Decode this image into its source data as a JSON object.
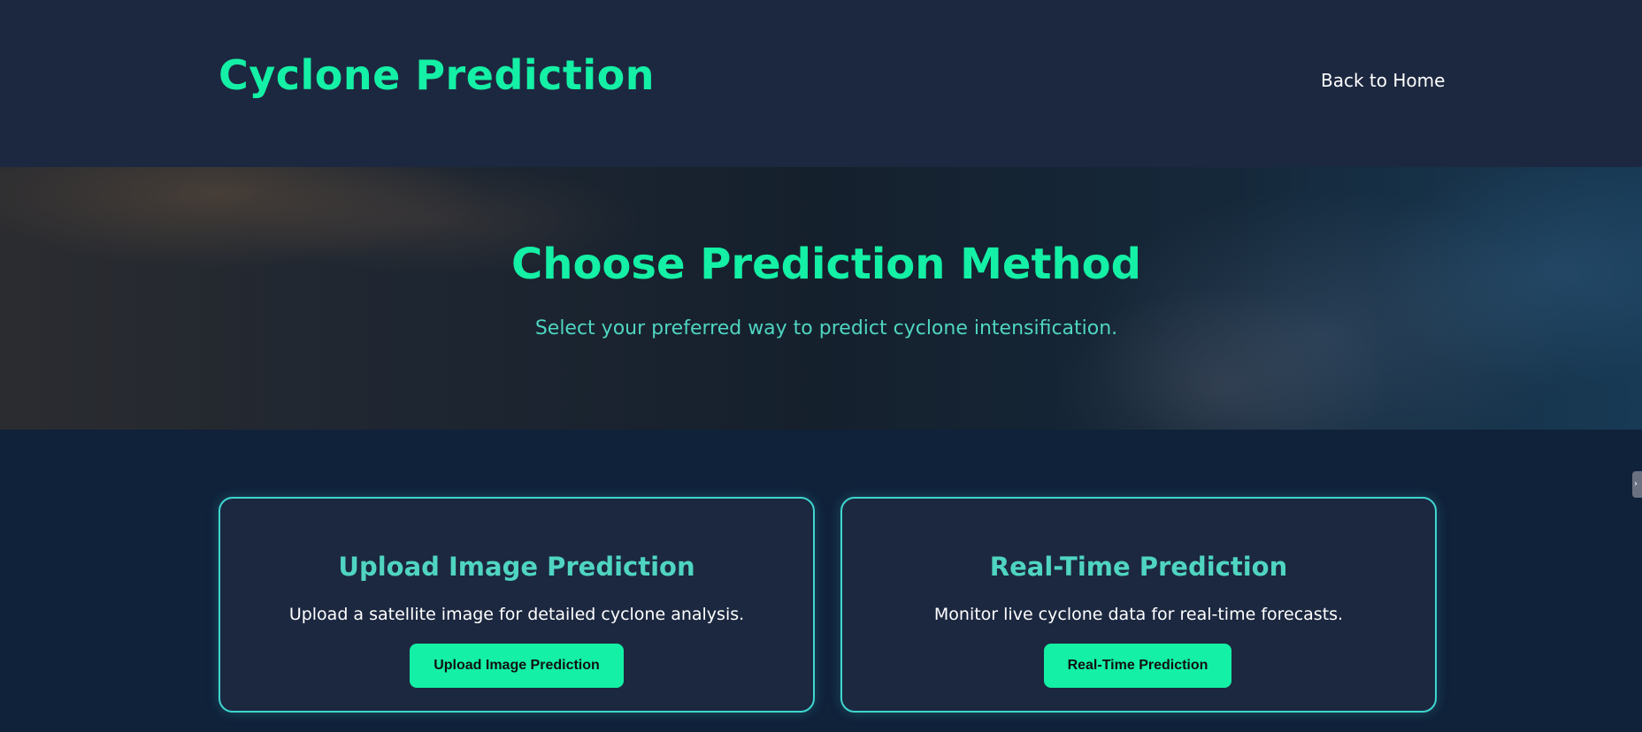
{
  "header": {
    "brand": "Cyclone Prediction",
    "nav_link": "Back to Home"
  },
  "hero": {
    "title": "Choose Prediction Method",
    "subtitle": "Select your preferred way to predict cyclone intensification."
  },
  "cards": [
    {
      "title": "Upload Image Prediction",
      "description": "Upload a satellite image for detailed cyclone analysis.",
      "button": "Upload Image Prediction"
    },
    {
      "title": "Real-Time Prediction",
      "description": "Monitor live cyclone data for real-time forecasts.",
      "button": "Real-Time Prediction"
    }
  ],
  "side_tab": {
    "icon": "chevron-right-icon",
    "glyph": "›"
  },
  "colors": {
    "accent": "#14f0a5",
    "secondary_accent": "#4fd5c1",
    "header_bg": "#1c2840",
    "page_bg": "#10213a",
    "card_border": "#3ed6cf"
  }
}
